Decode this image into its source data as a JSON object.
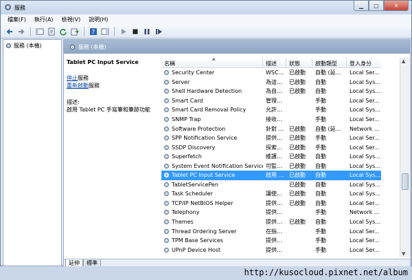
{
  "window": {
    "title": "服務"
  },
  "menubar": {
    "items": [
      "檔案(F)",
      "執行(A)",
      "檢視(V)",
      "說明(H)"
    ]
  },
  "tree": {
    "root_label": "服務 (本機)"
  },
  "pane": {
    "header": "服務 (本機)"
  },
  "detail": {
    "service_name": "Tablet PC Input Service",
    "stop_link": "停止",
    "stop_suffix": "服務",
    "restart_link": "重新啟動",
    "restart_suffix": "服務",
    "desc_label": "描述:",
    "desc_text": "啟用 Tablet PC 手寫筆和筆跡功能"
  },
  "table": {
    "columns": [
      "名稱",
      "描述",
      "狀態",
      "啟動類型",
      "登入身分"
    ],
    "rows": [
      {
        "name": "Security Center",
        "desc": "WSC...",
        "status": "已啟動",
        "type": "自動 (延...",
        "logon": "Local Ser..."
      },
      {
        "name": "Server",
        "desc": "為這...",
        "status": "已啟動",
        "type": "自動",
        "logon": "Local Sys..."
      },
      {
        "name": "Shell Hardware Detection",
        "desc": "為自...",
        "status": "已啟動",
        "type": "自動",
        "logon": "Local Sys..."
      },
      {
        "name": "Smart Card",
        "desc": "管理...",
        "status": "",
        "type": "手動",
        "logon": "Local Ser..."
      },
      {
        "name": "Smart Card Removal Policy",
        "desc": "允許...",
        "status": "",
        "type": "手動",
        "logon": "Local Sys..."
      },
      {
        "name": "SNMP Trap",
        "desc": "接收...",
        "status": "",
        "type": "手動",
        "logon": "Local Ser..."
      },
      {
        "name": "Software Protection",
        "desc": "針對 ...",
        "status": "已啟動",
        "type": "自動 (延...",
        "logon": "Network ..."
      },
      {
        "name": "SPP Notification Service",
        "desc": "提供...",
        "status": "已啟動",
        "type": "手動",
        "logon": "Local Ser..."
      },
      {
        "name": "SSDP Discovery",
        "desc": "探索...",
        "status": "已啟動",
        "type": "手動",
        "logon": "Local Ser..."
      },
      {
        "name": "Superfetch",
        "desc": "維護...",
        "status": "已啟動",
        "type": "自動",
        "logon": "Local Sys..."
      },
      {
        "name": "System Event Notification Service",
        "desc": "可監...",
        "status": "已啟動",
        "type": "自動",
        "logon": "Local Sys..."
      },
      {
        "name": "Tablet PC Input Service",
        "desc": "啟用 ...",
        "status": "已啟動",
        "type": "自動",
        "logon": "Local Sys...",
        "selected": true
      },
      {
        "name": "TabletServicePen",
        "desc": "",
        "status": "已啟動",
        "type": "自動",
        "logon": "Local Sys..."
      },
      {
        "name": "Task Scheduler",
        "desc": "讓使...",
        "status": "已啟動",
        "type": "自動",
        "logon": "Local Sys..."
      },
      {
        "name": "TCP/IP NetBIOS Helper",
        "desc": "提供...",
        "status": "已啟動",
        "type": "自動",
        "logon": "Local Ser..."
      },
      {
        "name": "Telephony",
        "desc": "提供...",
        "status": "",
        "type": "手動",
        "logon": "Network ..."
      },
      {
        "name": "Themes",
        "desc": "提供...",
        "status": "已啟動",
        "type": "自動",
        "logon": "Local Sys..."
      },
      {
        "name": "Thread Ordering Server",
        "desc": "在指...",
        "status": "",
        "type": "手動",
        "logon": "Local Ser..."
      },
      {
        "name": "TPM Base Services",
        "desc": "提供...",
        "status": "",
        "type": "手動",
        "logon": "Local Ser..."
      },
      {
        "name": "UPnP Device Host",
        "desc": "提供...",
        "status": "",
        "type": "手動",
        "logon": "Local Ser..."
      }
    ]
  },
  "tabs": [
    "延伸",
    "標準"
  ],
  "watermark": "http://kusocloud.pixnet.net/album",
  "colors": {
    "selection": "#3399ff",
    "link": "#0645ad",
    "header": "#8ea6c4"
  }
}
